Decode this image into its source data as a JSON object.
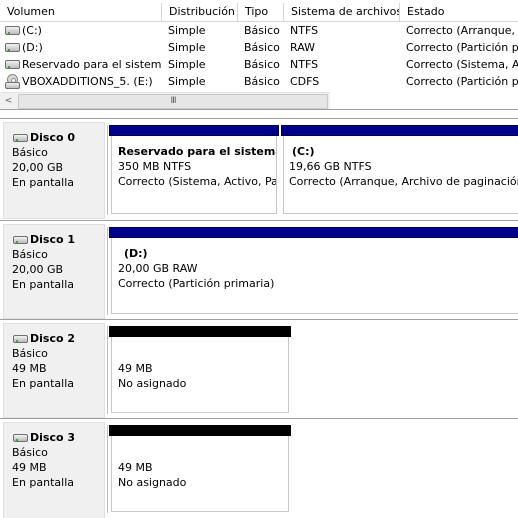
{
  "volume_list": {
    "columns": [
      "Volumen",
      "Distribución",
      "Tipo",
      "Sistema de archivos",
      "Estado"
    ],
    "rows": [
      {
        "icon": "drive-icon",
        "volume": "(C:)",
        "layout": "Simple",
        "type": "Básico",
        "fs": "NTFS",
        "status": "Correcto (Arranque, A"
      },
      {
        "icon": "drive-icon",
        "volume": "(D:)",
        "layout": "Simple",
        "type": "Básico",
        "fs": "RAW",
        "status": "Correcto (Partición pr"
      },
      {
        "icon": "drive-icon",
        "volume": "Reservado para el sistema",
        "layout": "Simple",
        "type": "Básico",
        "fs": "NTFS",
        "status": "Correcto (Sistema, Ac"
      },
      {
        "icon": "cd-drive-icon",
        "volume": "VBOXADDITIONS_5. (E:)",
        "layout": "Simple",
        "type": "Básico",
        "fs": "CDFS",
        "status": "Correcto (Partición pr"
      }
    ],
    "scroll_left": "<",
    "scroll_thumb": "III"
  },
  "disks": [
    {
      "title": "Disco 0",
      "type": "Básico",
      "size": "20,00 GB",
      "status": "En pantalla",
      "partitions": [
        {
          "name": "Reservado para el sistema",
          "size": "350 MB NTFS",
          "status": "Correcto (Sistema, Activo, Par"
        },
        {
          "name": "(C:)",
          "size": "19,66 GB NTFS",
          "status": "Correcto (Arranque, Archivo de paginación,"
        }
      ]
    },
    {
      "title": "Disco 1",
      "type": "Básico",
      "size": "20,00 GB",
      "status": "En pantalla",
      "partitions": [
        {
          "name": "(D:)",
          "size": "20,00 GB RAW",
          "status": "Correcto (Partición primaria)"
        }
      ]
    },
    {
      "title": "Disco 2",
      "type": "Básico",
      "size": "49 MB",
      "status": "En pantalla",
      "partitions": [
        {
          "size": "49 MB",
          "status": "No asignado"
        }
      ]
    },
    {
      "title": "Disco 3",
      "type": "Básico",
      "size": "49 MB",
      "status": "En pantalla",
      "partitions": [
        {
          "size": "49 MB",
          "status": "No asignado"
        }
      ]
    }
  ],
  "colors": {
    "primary_partition_bar": "#00008b",
    "unallocated_bar": "#000000",
    "label_background": "#f0f0f0"
  }
}
